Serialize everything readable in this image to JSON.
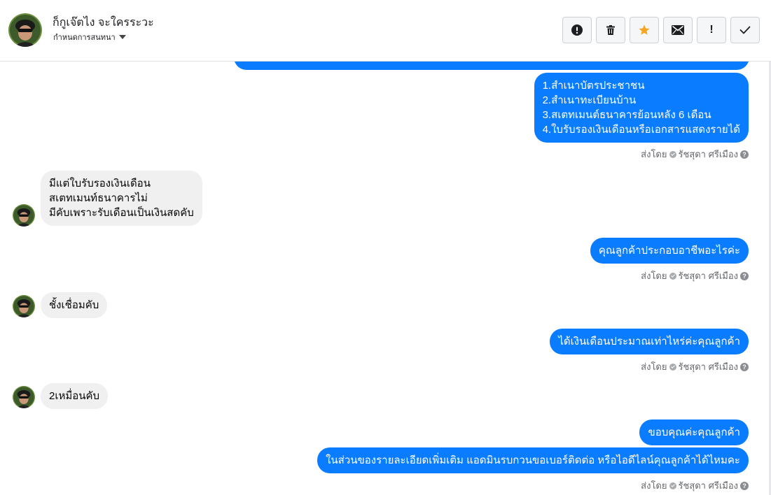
{
  "header": {
    "contact_name": "ก็กูเจ๊ตไง จะใครระวะ",
    "assign_label": "กำหนดการสนทนา",
    "toolbar": {
      "spam_icon": "alert-circle-icon",
      "delete_icon": "trash-icon",
      "star_icon": "star-icon",
      "mail_icon": "envelope-icon",
      "follow_up_label": "!",
      "done_icon": "checkmark-icon",
      "star_color": "#f5a623"
    }
  },
  "messages": [
    {
      "side": "out",
      "lines": [
        "1.สำเนาบัตรประชาชน",
        "2.สำเนาทะเบียนบ้าน",
        "3.สเตทเมนต์ธนาคารย้อนหลัง 6 เดือน",
        "4.ใบรับรองเงินเดือนหรือเอกสารแสดงรายได้"
      ]
    },
    {
      "side": "in",
      "lines": [
        "มีแต่ใบรับรองเงินเดือน",
        "สเตทเมนท์ธนาคารไม่",
        "มีคับเพราะรับเดือนเป็นเงินสดคับ"
      ]
    },
    {
      "side": "out",
      "lines": [
        "คุณลูกค้าประกอบอาชีพอะไรค่ะ"
      ]
    },
    {
      "side": "in",
      "lines": [
        "ชั้งเชื่อมคับ"
      ]
    },
    {
      "side": "out",
      "lines": [
        "ได้เงินเดือนประมาณเท่าไหร่ค่ะคุณลูกค้า"
      ]
    },
    {
      "side": "in",
      "lines": [
        "2เหมื่อนคับ"
      ]
    },
    {
      "side": "out",
      "lines": [
        "ขอบคุณค่ะคุณลูกค้า"
      ]
    },
    {
      "side": "out",
      "lines": [
        "ในส่วนของรายละเอียดเพิ่มเติม แอดมินรบกวนขอเบอร์ติดต่อ หรือไอดีไลน์คุณลูกค้าได้ไหมคะ"
      ]
    }
  ],
  "sent_by": {
    "prefix": "ส่งโดย",
    "agent": "รัชสุดา ศรีเมือง"
  },
  "colors": {
    "outgoing_bubble": "#0a7cff",
    "incoming_bubble": "#f0f0f0"
  }
}
